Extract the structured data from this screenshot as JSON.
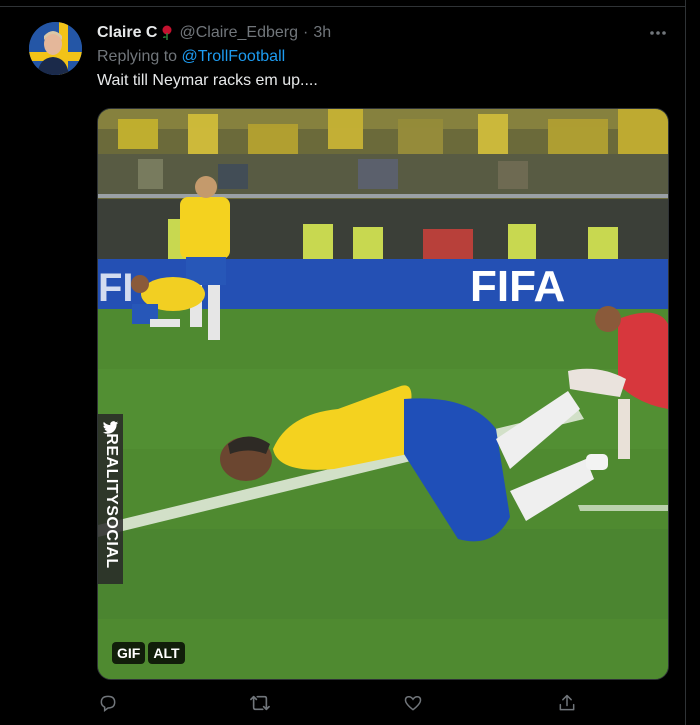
{
  "tweet": {
    "display_name": "Claire C",
    "handle": "@Claire_Edberg",
    "separator": "·",
    "time": "3h",
    "replying_prefix": "Replying to",
    "replying_to": "@TrollFootball",
    "text": "Wait till Neymar racks em up...."
  },
  "media": {
    "badges": [
      "GIF",
      "ALT"
    ],
    "banner_text": "FIFA",
    "watermark": "REALITYSOCIAL"
  },
  "actions": {
    "icons": [
      "reply-icon",
      "retweet-icon",
      "like-icon",
      "share-icon"
    ]
  },
  "colors": {
    "background": "#000000",
    "text_primary": "#e7e9ea",
    "text_secondary": "#71767b",
    "link": "#1d9bf0",
    "pitch": "#4f8a30",
    "jersey_yellow": "#f4d21f",
    "shorts_blue": "#1f4fb8"
  }
}
